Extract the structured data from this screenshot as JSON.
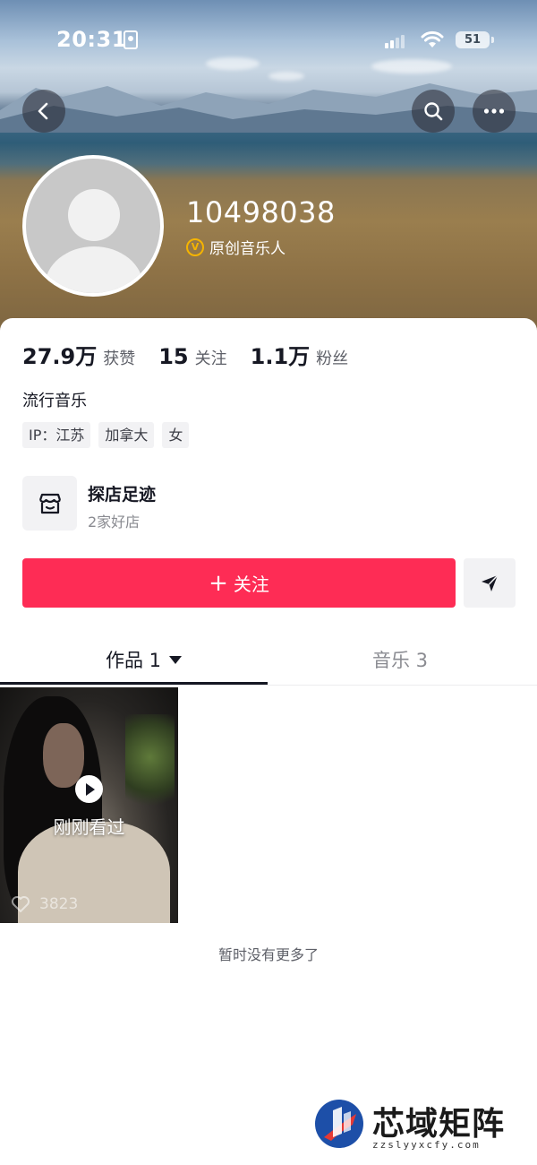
{
  "status_bar": {
    "time": "20:31",
    "battery": "51",
    "icons": [
      "id-card-icon",
      "signal-icon",
      "wifi-icon",
      "battery-icon"
    ]
  },
  "header": {
    "back_icon": "back-icon",
    "search_icon": "search-icon",
    "more_icon": "more-icon"
  },
  "profile": {
    "username": "10498038",
    "verify_badge": "V",
    "verify_label": "原创音乐人",
    "stats": [
      {
        "value": "27.9万",
        "label": "获赞"
      },
      {
        "value": "15",
        "label": "关注"
      },
      {
        "value": "1.1万",
        "label": "粉丝"
      }
    ],
    "bio": "流行音乐",
    "tags": [
      "IP：江苏",
      "加拿大",
      "女"
    ]
  },
  "shop": {
    "title": "探店足迹",
    "subtitle": "2家好店"
  },
  "actions": {
    "follow_plus": "+",
    "follow_label": "关注"
  },
  "tabs": [
    {
      "label": "作品 1",
      "active": true
    },
    {
      "label": "音乐 3",
      "active": false
    }
  ],
  "videos": [
    {
      "overlay": "刚刚看过",
      "likes": "3823"
    }
  ],
  "footer": {
    "no_more": "暂时没有更多了"
  },
  "watermark": {
    "title": "芯域矩阵",
    "url": "zzslyyxcfy.com"
  },
  "colors": {
    "accent": "#fe2c55",
    "verify": "#f5b400",
    "text_primary": "#161823",
    "text_secondary": "#8a8b91"
  }
}
